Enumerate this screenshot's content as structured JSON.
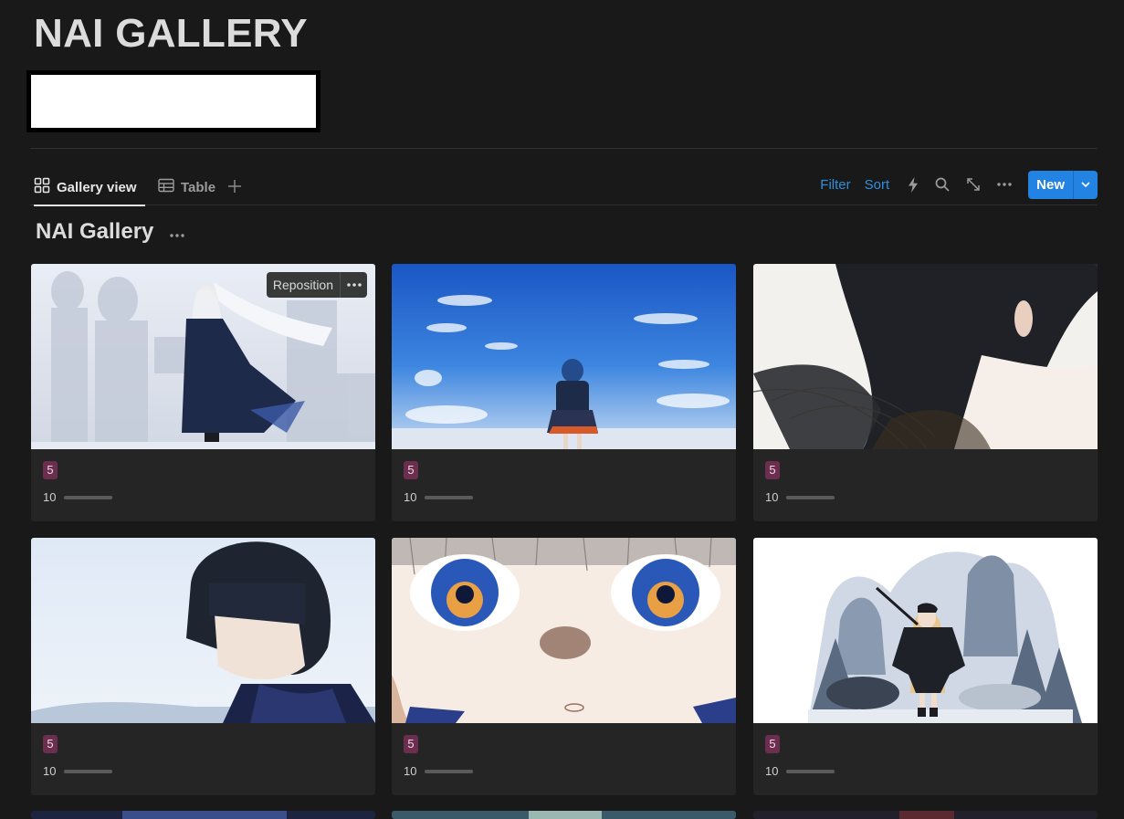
{
  "page": {
    "title": "NAI GALLERY"
  },
  "views": {
    "tabs": [
      {
        "label": "Gallery view",
        "icon": "grid-icon",
        "active": true
      },
      {
        "label": "Table",
        "icon": "table-icon",
        "active": false
      }
    ],
    "add_icon": "plus-icon"
  },
  "toolbar": {
    "filter_label": "Filter",
    "sort_label": "Sort",
    "icons": [
      "lightning-icon",
      "search-icon",
      "expand-icon",
      "more-icon"
    ],
    "new_label": "New",
    "accent_color": "#2383e2",
    "link_color": "#2f8fe0"
  },
  "database": {
    "title": "NAI Gallery"
  },
  "card_controls": {
    "reposition_label": "Reposition"
  },
  "cards": [
    {
      "tag": "5",
      "number": "10",
      "progress": 1.0,
      "cover": "girl in dark coat with long white hair, misty silhouettes"
    },
    {
      "tag": "5",
      "number": "10",
      "progress": 1.0,
      "cover": "girl with backpack under blue sky with clouds"
    },
    {
      "tag": "5",
      "number": "10",
      "progress": 1.0,
      "cover": "close-up of dark hair and ear on white background"
    },
    {
      "tag": "5",
      "number": "10",
      "progress": 1.0,
      "cover": "girl with short black bob hair in snow"
    },
    {
      "tag": "5",
      "number": "10",
      "progress": 1.0,
      "cover": "close-up of blue eyes with light shadows"
    },
    {
      "tag": "5",
      "number": "10",
      "progress": 1.0,
      "cover": "blonde girl in dark cloak, snowy mountain landscape"
    }
  ],
  "colors": {
    "background": "#191919",
    "card": "#252525",
    "tag_bg": "#6b2e4e"
  }
}
